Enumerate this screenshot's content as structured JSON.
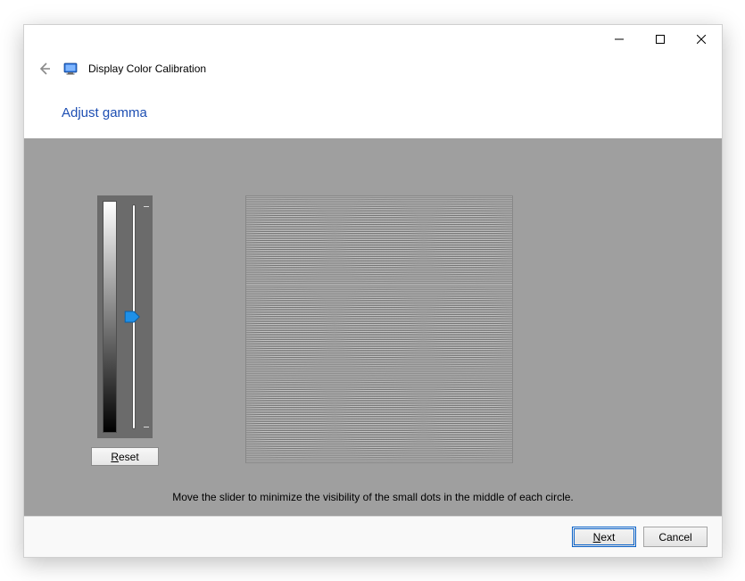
{
  "window": {
    "title": "Display Color Calibration",
    "heading": "Adjust gamma",
    "instruction": "Move the slider to minimize the visibility of the small dots in the middle of each circle."
  },
  "controls": {
    "reset_label": "Reset",
    "reset_accel": "R",
    "next_label": "Next",
    "next_accel": "N",
    "cancel_label": "Cancel"
  },
  "slider": {
    "value": 50,
    "min": 0,
    "max": 100
  }
}
